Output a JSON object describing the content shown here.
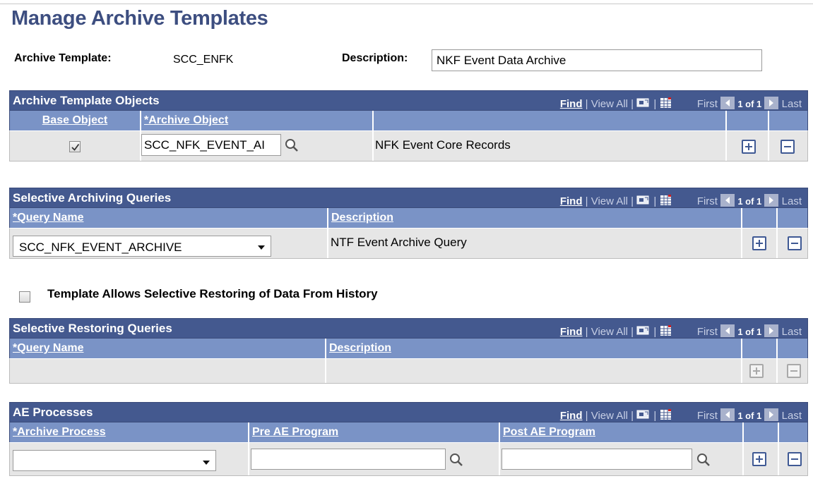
{
  "page": {
    "title": "Manage Archive Templates",
    "archive_template_label": "Archive Template:",
    "archive_template_value": "SCC_ENFK",
    "description_label": "Description:",
    "description_value": "NKF Event Data Archive"
  },
  "nav": {
    "find": "Find",
    "sep1": " | ",
    "view_all": "View All",
    "sep2": " | ",
    "sep3": " | ",
    "first": "First",
    "count": "1 of 1",
    "last": "Last"
  },
  "grid_objects": {
    "title": "Archive Template Objects",
    "columns": [
      "Base Object",
      "*Archive Object"
    ],
    "row": {
      "base_object_checked": true,
      "archive_object": "SCC_NFK_EVENT_AI",
      "description": "NFK Event Core Records"
    }
  },
  "grid_archiving": {
    "title": "Selective Archiving Queries",
    "columns": [
      "*Query Name",
      "Description"
    ],
    "row": {
      "query_name": "SCC_NFK_EVENT_ARCHIVE",
      "description": "NTF Event Archive Query"
    }
  },
  "restore_checkbox": {
    "label": "Template Allows Selective Restoring of Data From History",
    "checked": false
  },
  "grid_restoring": {
    "title": "Selective Restoring Queries",
    "columns": [
      "*Query Name",
      "Description"
    ]
  },
  "grid_ae": {
    "title": "AE Processes",
    "columns": [
      "*Archive Process",
      "Pre AE Program",
      "Post AE Program"
    ],
    "row": {
      "archive_process": "",
      "pre_ae_program": "",
      "post_ae_program": ""
    }
  },
  "colors": {
    "grid_header": "#44598f",
    "column_header": "#7a93c6",
    "title_text": "#3d4e80",
    "row_bg": "#e6e6e6"
  }
}
